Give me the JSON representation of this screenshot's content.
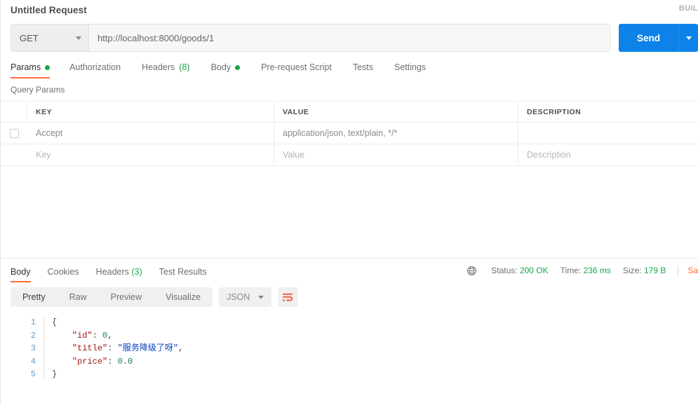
{
  "header": {
    "request_title": "Untitled Request",
    "build_label": "BUIL"
  },
  "url_bar": {
    "method": "GET",
    "url": "http://localhost:8000/goods/1",
    "send_label": "Send"
  },
  "request_tabs": [
    {
      "label": "Params",
      "indicator": "dot",
      "active": true
    },
    {
      "label": "Authorization",
      "indicator": "",
      "active": false
    },
    {
      "label": "Headers",
      "indicator": "(8)",
      "active": false
    },
    {
      "label": "Body",
      "indicator": "dot",
      "active": false
    },
    {
      "label": "Pre-request Script",
      "indicator": "",
      "active": false
    },
    {
      "label": "Tests",
      "indicator": "",
      "active": false
    },
    {
      "label": "Settings",
      "indicator": "",
      "active": false
    }
  ],
  "params": {
    "section_label": "Query Params",
    "columns": [
      "KEY",
      "VALUE",
      "DESCRIPTION"
    ],
    "rows": [
      {
        "key": "Accept",
        "value": "application/json, text/plain, */*",
        "description": "",
        "checked": false,
        "placeholder_row": false
      },
      {
        "key": "Key",
        "value": "Value",
        "description": "Description",
        "checked": false,
        "placeholder_row": true
      }
    ]
  },
  "response": {
    "tabs": [
      {
        "label": "Body",
        "indicator": "",
        "active": true
      },
      {
        "label": "Cookies",
        "indicator": "",
        "active": false
      },
      {
        "label": "Headers",
        "indicator": "(3)",
        "active": false
      },
      {
        "label": "Test Results",
        "indicator": "",
        "active": false
      }
    ],
    "meta": {
      "status_label": "Status:",
      "status_value": "200 OK",
      "time_label": "Time:",
      "time_value": "236 ms",
      "size_label": "Size:",
      "size_value": "179 B",
      "save_response": "Sa"
    },
    "view_modes": [
      "Pretty",
      "Raw",
      "Preview",
      "Visualize"
    ],
    "active_view_mode": "Pretty",
    "format": "JSON",
    "body_lines": [
      {
        "n": "1",
        "tokens": [
          {
            "t": "{",
            "c": "punct"
          }
        ]
      },
      {
        "n": "2",
        "tokens": [
          {
            "t": "    ",
            "c": "punct"
          },
          {
            "t": "\"id\"",
            "c": "key"
          },
          {
            "t": ": ",
            "c": "punct"
          },
          {
            "t": "0",
            "c": "num"
          },
          {
            "t": ",",
            "c": "punct"
          }
        ]
      },
      {
        "n": "3",
        "tokens": [
          {
            "t": "    ",
            "c": "punct"
          },
          {
            "t": "\"title\"",
            "c": "key"
          },
          {
            "t": ": ",
            "c": "punct"
          },
          {
            "t": "\"服务降级了呀\"",
            "c": "str"
          },
          {
            "t": ",",
            "c": "punct"
          }
        ]
      },
      {
        "n": "4",
        "tokens": [
          {
            "t": "    ",
            "c": "punct"
          },
          {
            "t": "\"price\"",
            "c": "key"
          },
          {
            "t": ": ",
            "c": "punct"
          },
          {
            "t": "0.0",
            "c": "num"
          }
        ]
      },
      {
        "n": "5",
        "tokens": [
          {
            "t": "}",
            "c": "punct"
          }
        ]
      }
    ]
  },
  "colors": {
    "accent_orange": "#ff6c37",
    "send_blue": "#0d82e8",
    "status_green": "#1aa64b"
  }
}
